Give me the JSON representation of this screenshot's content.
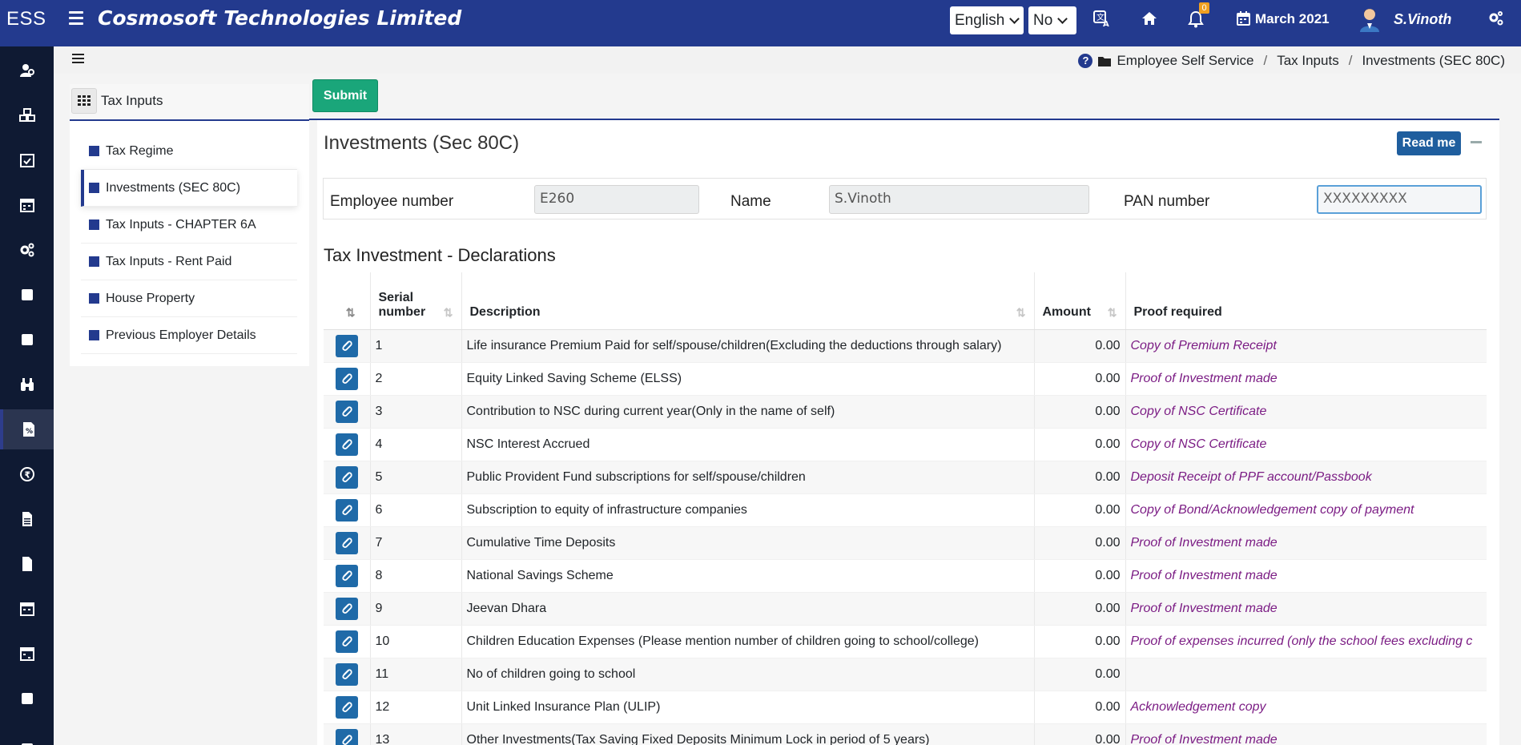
{
  "app": {
    "brand": "ESS",
    "company": "Cosmosoft Technologies Limited",
    "language": "English",
    "toggle": "No",
    "notifications": "0",
    "period": "March 2021",
    "user": "S.Vinoth"
  },
  "breadcrumb": {
    "items": [
      "Employee Self Service",
      "Tax Inputs",
      "Investments (SEC 80C)"
    ]
  },
  "left_menu": {
    "title": "Tax Inputs",
    "items": [
      {
        "label": "Tax Regime"
      },
      {
        "label": "Investments (SEC 80C)"
      },
      {
        "label": "Tax Inputs - CHAPTER 6A"
      },
      {
        "label": "Tax Inputs - Rent Paid"
      },
      {
        "label": "House Property"
      },
      {
        "label": "Previous Employer Details"
      }
    ]
  },
  "toolbar": {
    "submit_label": "Submit"
  },
  "panel": {
    "title": "Investments (Sec 80C)",
    "readme_label": "Read me"
  },
  "employee": {
    "number_label": "Employee number",
    "number_value": "E260",
    "name_label": "Name",
    "name_value": "S.Vinoth",
    "pan_label": "PAN number",
    "pan_value": "XXXXXXXXX"
  },
  "declarations": {
    "title": "Tax Investment - Declarations",
    "columns": [
      "Serial number",
      "Description",
      "Amount",
      "Proof required"
    ],
    "rows": [
      {
        "serial": "1",
        "description": "Life insurance Premium Paid for self/spouse/children(Excluding the deductions through salary)",
        "amount": "0.00",
        "proof": "Copy of Premium Receipt"
      },
      {
        "serial": "2",
        "description": "Equity Linked Saving Scheme (ELSS)",
        "amount": "0.00",
        "proof": "Proof of Investment made"
      },
      {
        "serial": "3",
        "description": "Contribution to NSC during current year(Only in the name of self)",
        "amount": "0.00",
        "proof": "Copy of NSC Certificate"
      },
      {
        "serial": "4",
        "description": "NSC Interest Accrued",
        "amount": "0.00",
        "proof": "Copy of NSC Certificate"
      },
      {
        "serial": "5",
        "description": "Public Provident Fund subscriptions for self/spouse/children",
        "amount": "0.00",
        "proof": "Deposit Receipt of PPF account/Passbook"
      },
      {
        "serial": "6",
        "description": "Subscription to equity of infrastructure companies",
        "amount": "0.00",
        "proof": "Copy of Bond/Acknowledgement copy of payment"
      },
      {
        "serial": "7",
        "description": "Cumulative Time Deposits",
        "amount": "0.00",
        "proof": "Proof of Investment made"
      },
      {
        "serial": "8",
        "description": "National Savings Scheme",
        "amount": "0.00",
        "proof": "Proof of Investment made"
      },
      {
        "serial": "9",
        "description": "Jeevan Dhara",
        "amount": "0.00",
        "proof": "Proof of Investment made"
      },
      {
        "serial": "10",
        "description": "Children Education Expenses (Please mention number of children going to school/college)",
        "amount": "0.00",
        "proof": "Proof of expenses incurred (only the school fees excluding c"
      },
      {
        "serial": "11",
        "description": "No of children going to school",
        "amount": "0.00",
        "proof": ""
      },
      {
        "serial": "12",
        "description": "Unit Linked Insurance Plan (ULIP)",
        "amount": "0.00",
        "proof": "Acknowledgement copy"
      },
      {
        "serial": "13",
        "description": "Other Investments(Tax Saving Fixed Deposits Minimum Lock in period of 5 years)",
        "amount": "0.00",
        "proof": "Proof of Investment made"
      }
    ]
  },
  "sidebar_icons": [
    "users-icon",
    "cubes-icon",
    "calendar-check-icon",
    "calendar-icon",
    "cogs-icon",
    "square-icon",
    "square-icon",
    "binoculars-icon",
    "tax-file-icon",
    "rupee-icon",
    "document-icon",
    "file-icon",
    "calendar-icon",
    "calendar-icon",
    "square-icon",
    "square-icon"
  ]
}
